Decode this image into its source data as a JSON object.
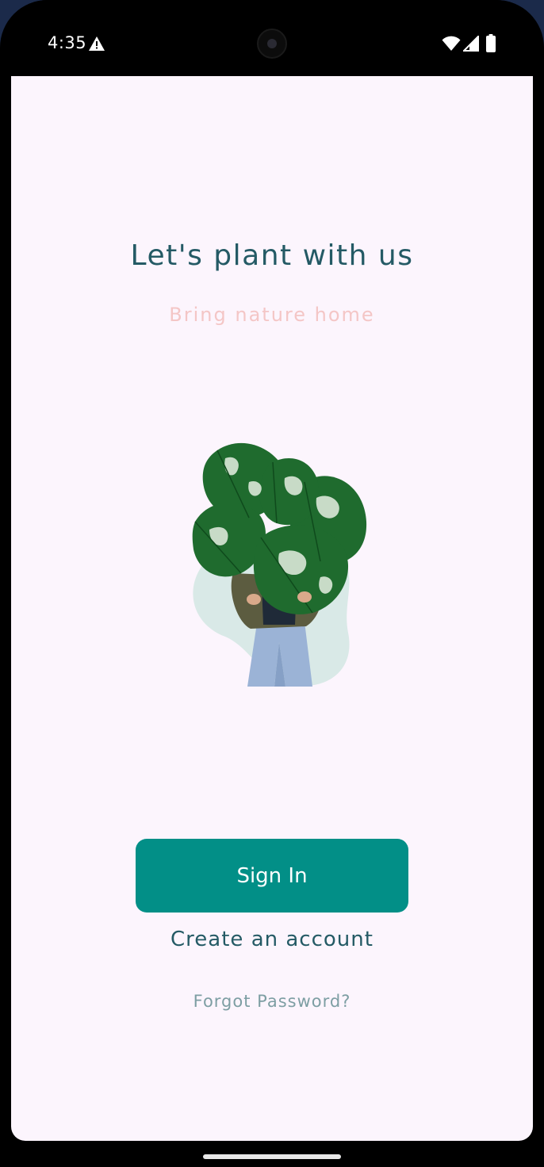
{
  "status_bar": {
    "time": "4:35",
    "icons": [
      "warning-icon",
      "wifi-icon",
      "signal-icon",
      "battery-icon"
    ]
  },
  "main": {
    "title": "Let's plant with us",
    "subtitle": "Bring nature home",
    "illustration": "person-holding-monstera-plant",
    "sign_in_label": "Sign In",
    "create_account_label": "Create an account",
    "forgot_password_label": "Forgot Password?"
  },
  "colors": {
    "background": "#fcf5fd",
    "title": "#245a65",
    "subtitle": "#f4c6c6",
    "primary_button": "#028f87",
    "muted_link": "#7d9ea3"
  }
}
